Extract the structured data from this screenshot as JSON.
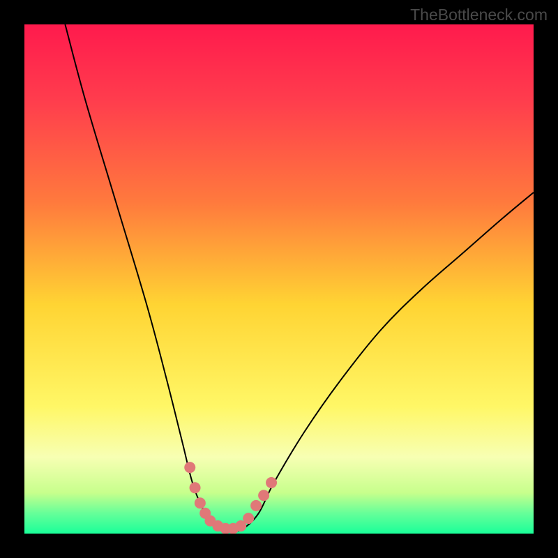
{
  "watermark": "TheBottleneck.com",
  "chart_data": {
    "type": "line",
    "title": "",
    "xlabel": "",
    "ylabel": "",
    "xlim": [
      0,
      100
    ],
    "ylim": [
      0,
      100
    ],
    "background": {
      "type": "vertical_gradient",
      "stops": [
        {
          "pos": 0.0,
          "color": "#ff1a4d"
        },
        {
          "pos": 0.15,
          "color": "#ff3d4d"
        },
        {
          "pos": 0.35,
          "color": "#ff7a3d"
        },
        {
          "pos": 0.55,
          "color": "#ffd433"
        },
        {
          "pos": 0.75,
          "color": "#fff766"
        },
        {
          "pos": 0.85,
          "color": "#f7ffb3"
        },
        {
          "pos": 0.92,
          "color": "#c7ff8c"
        },
        {
          "pos": 0.96,
          "color": "#66ff99"
        },
        {
          "pos": 1.0,
          "color": "#1aff99"
        }
      ]
    },
    "curve": {
      "description": "V-shaped bottleneck curve, steep left descent, asymmetric shallow right ascent",
      "points": [
        {
          "x": 8,
          "y": 100
        },
        {
          "x": 12,
          "y": 85
        },
        {
          "x": 18,
          "y": 65
        },
        {
          "x": 24,
          "y": 45
        },
        {
          "x": 28,
          "y": 30
        },
        {
          "x": 31,
          "y": 18
        },
        {
          "x": 33,
          "y": 10
        },
        {
          "x": 35,
          "y": 5
        },
        {
          "x": 37,
          "y": 2
        },
        {
          "x": 39,
          "y": 0.5
        },
        {
          "x": 41,
          "y": 0.5
        },
        {
          "x": 43,
          "y": 1
        },
        {
          "x": 46,
          "y": 4
        },
        {
          "x": 49,
          "y": 10
        },
        {
          "x": 55,
          "y": 20
        },
        {
          "x": 62,
          "y": 30
        },
        {
          "x": 70,
          "y": 40
        },
        {
          "x": 78,
          "y": 48
        },
        {
          "x": 86,
          "y": 55
        },
        {
          "x": 94,
          "y": 62
        },
        {
          "x": 100,
          "y": 67
        }
      ]
    },
    "highlight_dots": {
      "color": "#e07878",
      "points": [
        {
          "x": 32.5,
          "y": 13
        },
        {
          "x": 33.5,
          "y": 9
        },
        {
          "x": 34.5,
          "y": 6
        },
        {
          "x": 35.5,
          "y": 4
        },
        {
          "x": 36.5,
          "y": 2.5
        },
        {
          "x": 38,
          "y": 1.5
        },
        {
          "x": 39.5,
          "y": 1
        },
        {
          "x": 41,
          "y": 1
        },
        {
          "x": 42.5,
          "y": 1.5
        },
        {
          "x": 44,
          "y": 3
        },
        {
          "x": 45.5,
          "y": 5.5
        },
        {
          "x": 47,
          "y": 7.5
        },
        {
          "x": 48.5,
          "y": 10
        }
      ]
    }
  }
}
